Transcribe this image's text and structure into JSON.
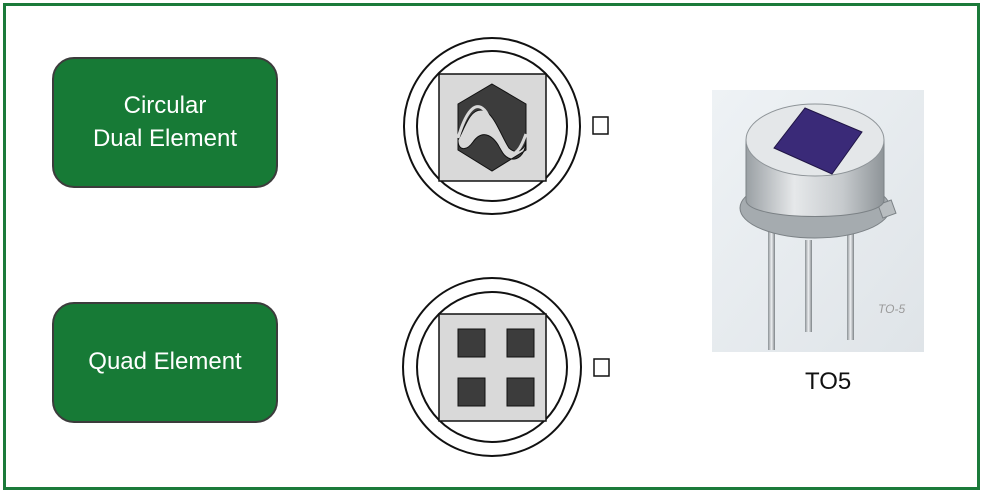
{
  "dual": {
    "line1": "Circular",
    "line2": "Dual Element"
  },
  "quad": {
    "label": "Quad Element"
  },
  "package": {
    "caption": "TO5",
    "image_tag": "TO-5"
  },
  "colors": {
    "frame": "#1b7a3a",
    "box": "#177a36",
    "element_fill": "#3c3c3c",
    "window": "#d9d9d9",
    "lens": "#3a2a78"
  }
}
